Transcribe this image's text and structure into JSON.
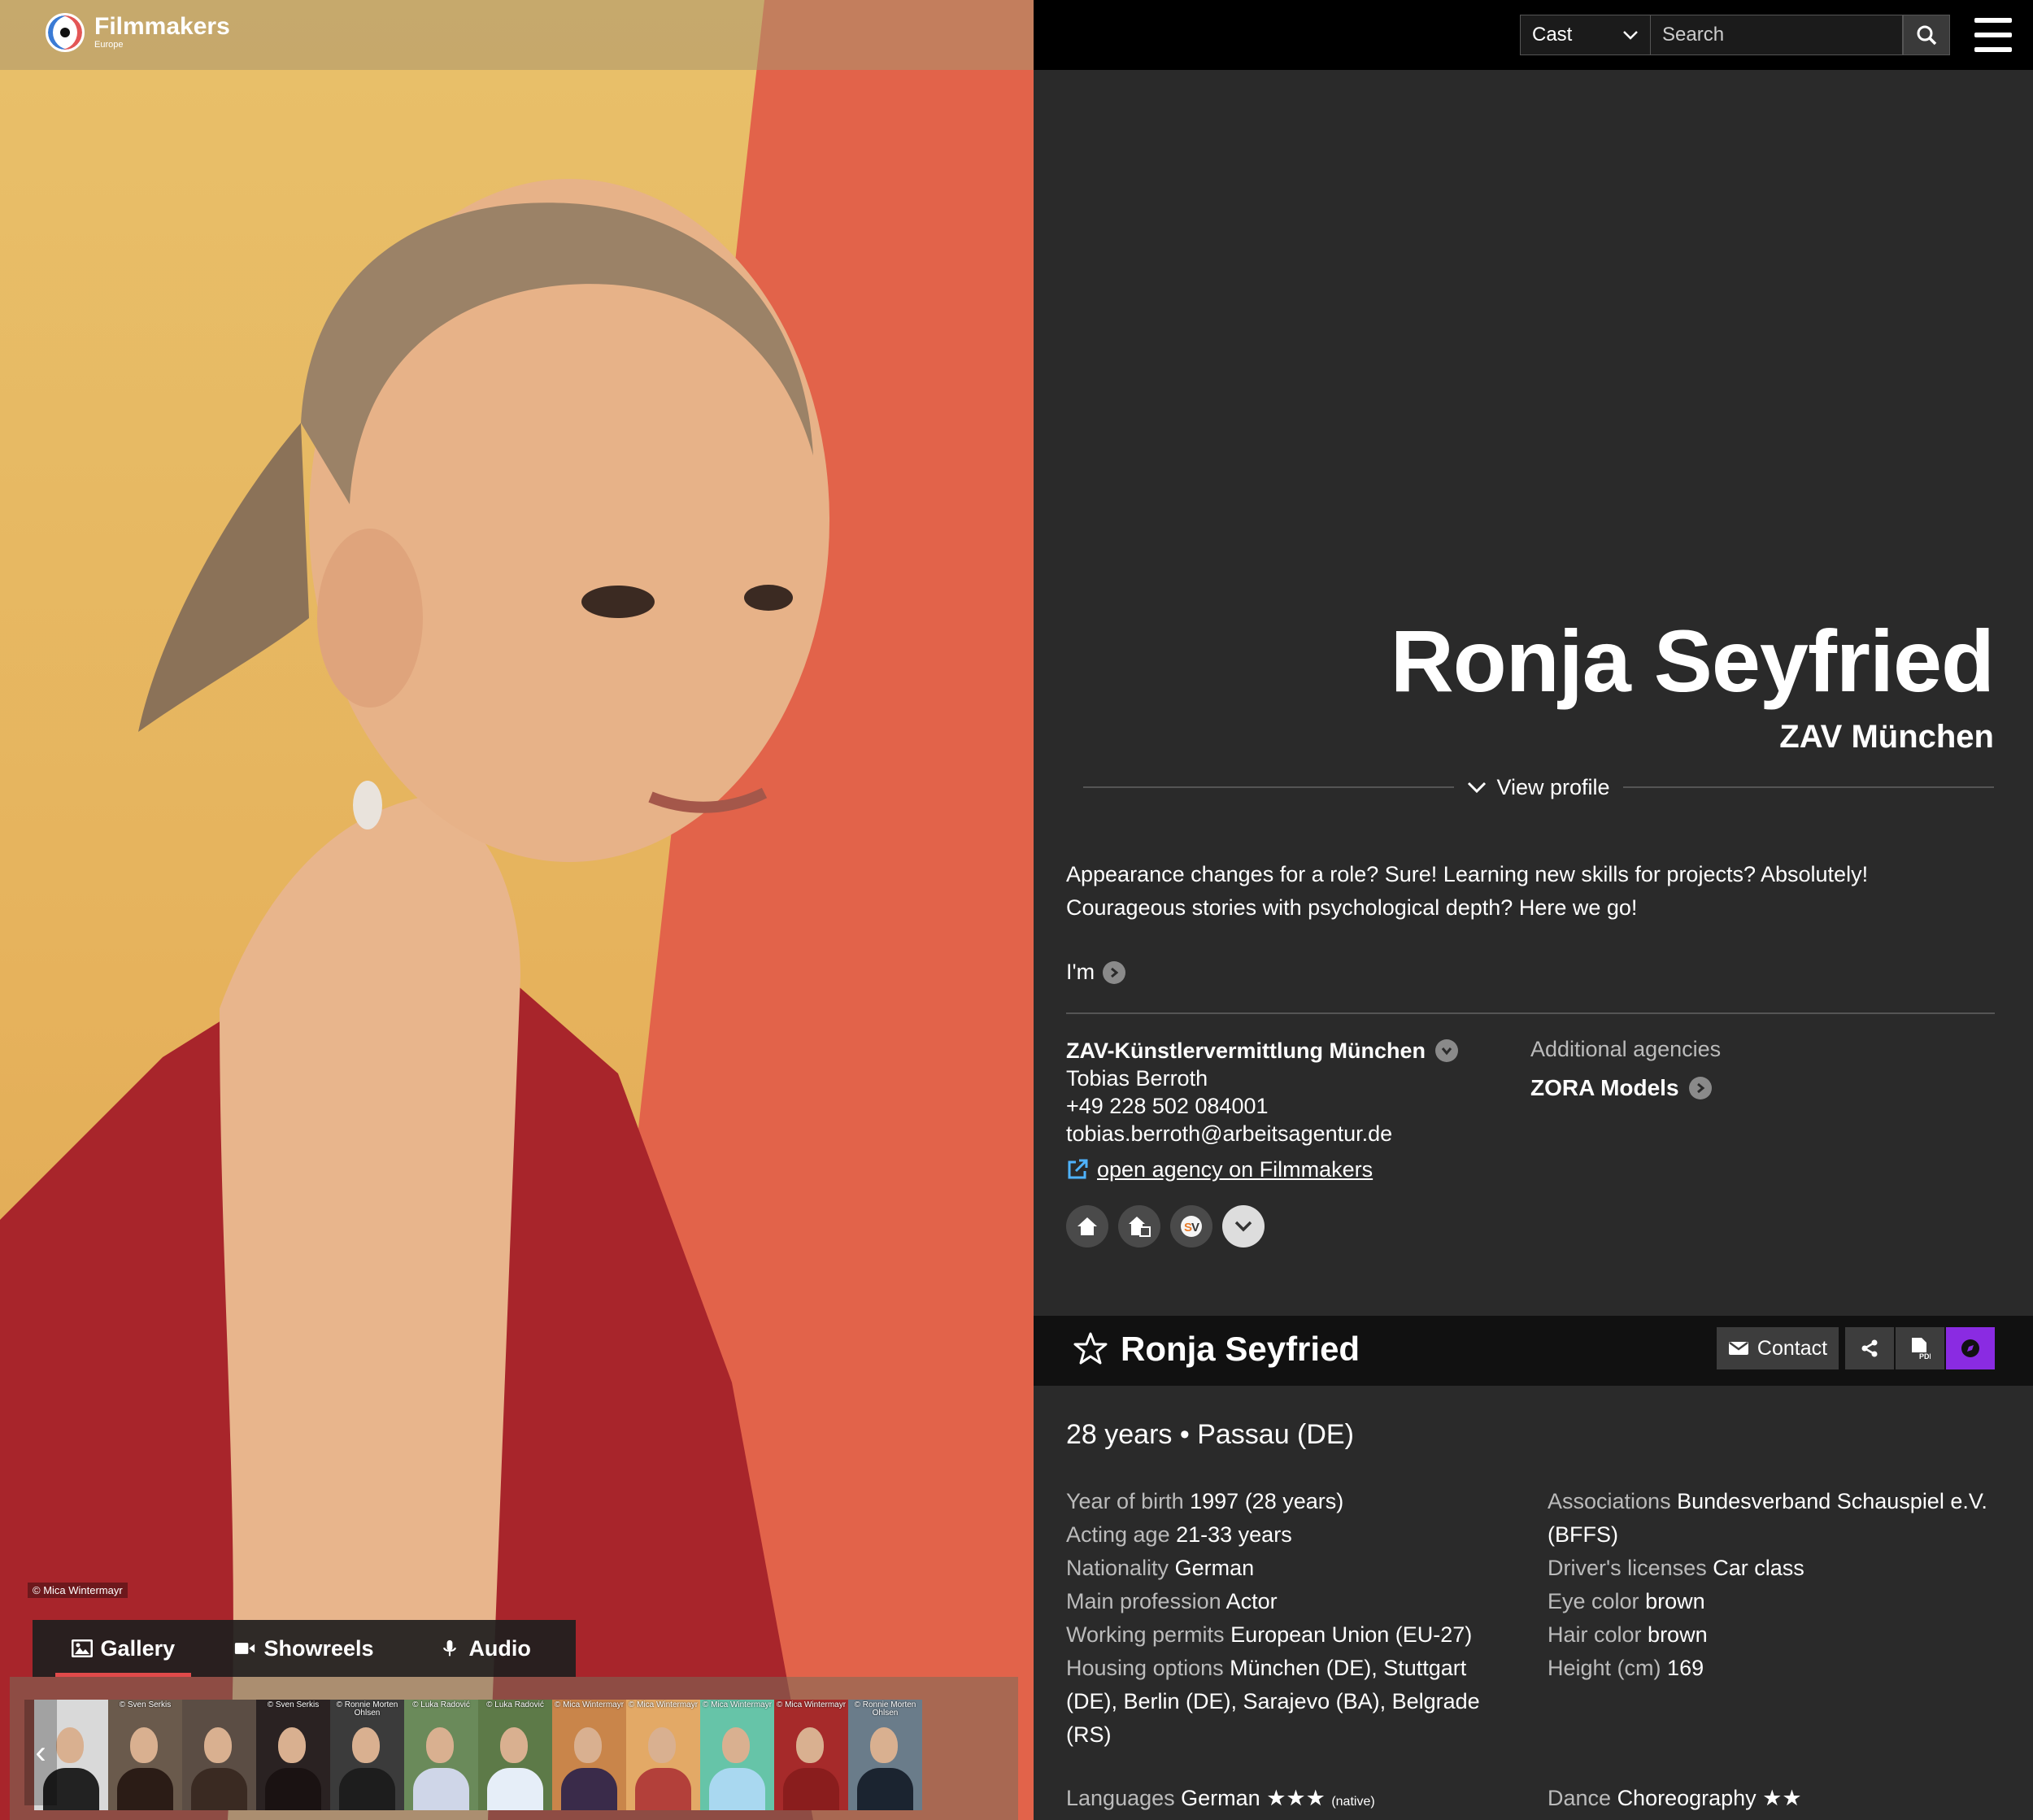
{
  "brand": {
    "name": "Filmmakers",
    "sub": "Europe"
  },
  "photo": {
    "copyright": "© Mica Wintermayr"
  },
  "media_tabs": [
    {
      "label": "Gallery",
      "icon": "image-icon",
      "active": true
    },
    {
      "label": "Showreels",
      "icon": "video-icon",
      "active": false
    },
    {
      "label": "Audio",
      "icon": "microphone-icon",
      "active": false
    }
  ],
  "thumbnails": [
    {
      "caption": "",
      "bg": "#d9d9d9",
      "fg": "#222"
    },
    {
      "caption": "© Sven Serkis",
      "bg": "#6a5a4c",
      "fg": "#2b1c16"
    },
    {
      "caption": "",
      "bg": "#5b4d44",
      "fg": "#3a2a22"
    },
    {
      "caption": "© Sven Serkis",
      "bg": "#2a2222",
      "fg": "#1a1212"
    },
    {
      "caption": "© Ronnie Morten Ohlsen",
      "bg": "#3b3b3b",
      "fg": "#1d1d1d"
    },
    {
      "caption": "© Luka Radović",
      "bg": "#6a8a5a",
      "fg": "#cfd6e8"
    },
    {
      "caption": "© Luka Radović",
      "bg": "#5d7a48",
      "fg": "#e6eef8"
    },
    {
      "caption": "© Mica Wintermayr",
      "bg": "#c9854a",
      "fg": "#3a2b4a"
    },
    {
      "caption": "© Mica Wintermayr",
      "bg": "#e3a966",
      "fg": "#b3403a"
    },
    {
      "caption": "© Mica Wintermayr",
      "bg": "#66c4a8",
      "fg": "#a9d8f0"
    },
    {
      "caption": "© Mica Wintermayr",
      "bg": "#a62a2a",
      "fg": "#8a1d1d"
    },
    {
      "caption": "© Ronnie Morten Ohlsen",
      "bg": "#6a7c8a",
      "fg": "#1b2430"
    }
  ],
  "search": {
    "category": "Cast",
    "placeholder": "Search"
  },
  "profile": {
    "name": "Ronja Seyfried",
    "agency_short": "ZAV München",
    "view_profile": "View profile",
    "bio": "Appearance changes for a role? Sure! Learning new skills for projects? Absolutely! Courageous stories with psychological depth? Here we go!",
    "im_label": "I'm"
  },
  "agency": {
    "name": "ZAV-Künstlervermittlung München",
    "contact": "Tobias Berroth",
    "phone": "+49 228 502 084001",
    "email": "tobias.berroth@arbeitsagentur.de",
    "link": "open agency on Filmmakers"
  },
  "additional": {
    "label": "Additional agencies",
    "name": "ZORA Models"
  },
  "actions": {
    "contact": "Contact"
  },
  "summary": "28 years • Passau (DE)",
  "facts_left": [
    {
      "k": "Year of birth",
      "v": "1997 (28 years)"
    },
    {
      "k": "Acting age",
      "v": "21-33 years"
    },
    {
      "k": "Nationality",
      "v": "German"
    },
    {
      "k": "Main profession",
      "v": "Actor"
    },
    {
      "k": "Working permits",
      "v": "European Union (EU-27)"
    },
    {
      "k": "Housing options",
      "v": "München (DE), Stuttgart (DE), Berlin (DE), Sarajevo (BA), Belgrade (RS)"
    }
  ],
  "facts_right": [
    {
      "k": "Associations",
      "v": "Bundesverband Schauspiel e.V. (BFFS)"
    },
    {
      "k": "Driver's licenses",
      "v": "Car class"
    },
    {
      "k": "Eye color",
      "v": "brown"
    },
    {
      "k": "Hair color",
      "v": "brown"
    },
    {
      "k": "Height (cm)",
      "v": "169"
    }
  ],
  "languages": {
    "k": "Languages",
    "v": "German ★★★",
    "note": "(native)"
  },
  "dance": {
    "k": "Dance",
    "v": "Choreography ★★"
  }
}
